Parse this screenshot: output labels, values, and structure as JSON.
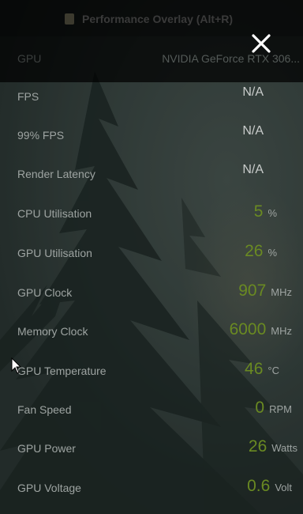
{
  "window": {
    "title": "Performance Overlay (Alt+R)",
    "close_icon": "close-icon"
  },
  "gpu": {
    "label": "GPU",
    "name": "NVIDIA GeForce RTX 306..."
  },
  "stats": [
    {
      "label": "FPS",
      "value": "N/A",
      "unit": ""
    },
    {
      "label": "99% FPS",
      "value": "N/A",
      "unit": ""
    },
    {
      "label": "Render Latency",
      "value": "N/A",
      "unit": ""
    },
    {
      "label": "CPU Utilisation",
      "value": "5",
      "unit": "%"
    },
    {
      "label": "GPU Utilisation",
      "value": "26",
      "unit": "%"
    },
    {
      "label": "GPU Clock",
      "value": "907",
      "unit": "MHz"
    },
    {
      "label": "Memory Clock",
      "value": "6000",
      "unit": "MHz"
    },
    {
      "label": "GPU Temperature",
      "value": "46",
      "unit": "°C"
    },
    {
      "label": "Fan Speed",
      "value": "0",
      "unit": "RPM"
    },
    {
      "label": "GPU Power",
      "value": "26",
      "unit": "Watts"
    },
    {
      "label": "GPU Voltage",
      "value": "0.6",
      "unit": "Volt"
    }
  ],
  "colors": {
    "value_green": "#6a8a22",
    "label_gray": "#9ea4a2",
    "na_white": "#c9cccb"
  }
}
